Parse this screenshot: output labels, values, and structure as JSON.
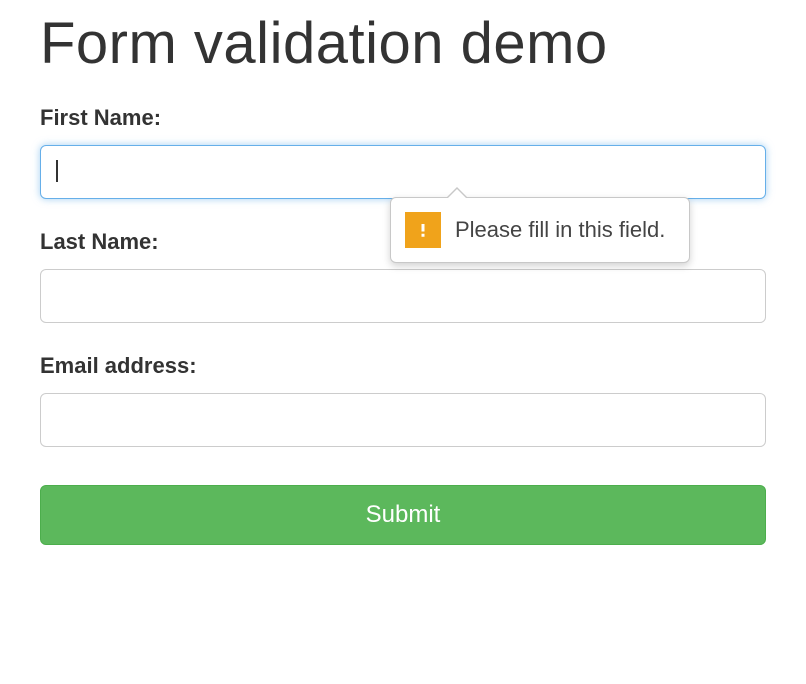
{
  "page": {
    "title": "Form validation demo"
  },
  "form": {
    "first_name": {
      "label": "First Name:",
      "value": ""
    },
    "last_name": {
      "label": "Last Name:",
      "value": ""
    },
    "email": {
      "label": "Email address:",
      "value": ""
    },
    "submit_label": "Submit"
  },
  "tooltip": {
    "message": "Please fill in this field."
  }
}
